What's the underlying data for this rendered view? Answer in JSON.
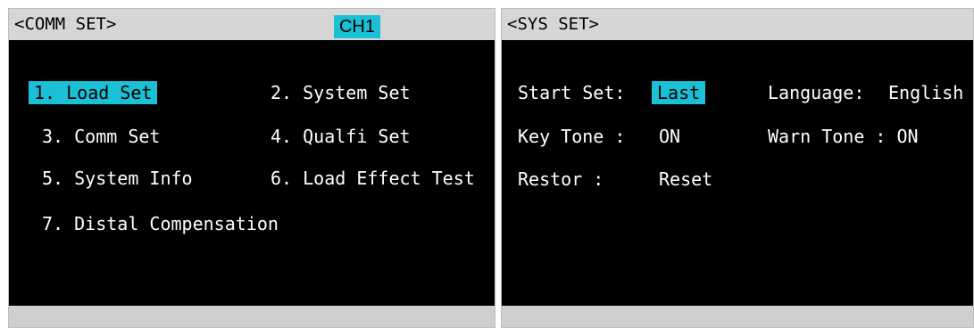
{
  "comm_panel": {
    "title": "<COMM SET>",
    "channel": "CH1",
    "menu": [
      {
        "label": "1. Load Set"
      },
      {
        "label": "2. System Set"
      },
      {
        "label": "3. Comm Set"
      },
      {
        "label": "4. Qualfi Set"
      },
      {
        "label": "5. System Info"
      },
      {
        "label": "6. Load Effect Test"
      },
      {
        "label": "7. Distal Compensation"
      }
    ]
  },
  "sys_panel": {
    "title": "<SYS SET>",
    "start_set_label": "Start Set:",
    "start_set_value": "Last",
    "language_label": "Language:",
    "language_value": "English",
    "key_tone_label": "Key Tone :",
    "key_tone_value": "ON",
    "warn_tone_label": "Warn Tone : ON",
    "restor_label": "Restor   :",
    "restor_value": "Reset"
  },
  "colors": {
    "highlight": "#1bbfd6",
    "screen_bg": "#000000",
    "header_bg": "#d6d6d6"
  }
}
